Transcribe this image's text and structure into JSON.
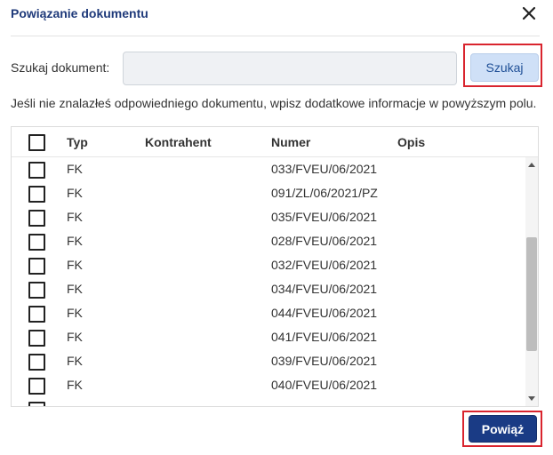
{
  "dialog": {
    "title": "Powiązanie dokumentu",
    "close_icon": "close-icon"
  },
  "search": {
    "label": "Szukaj dokument:",
    "value": "",
    "placeholder": "",
    "button_label": "Szukaj"
  },
  "info_text": "Jeśli nie znalazłeś odpowiedniego dokumentu, wpisz dodatkowe informacje w powyższym polu.",
  "table": {
    "headers": {
      "typ": "Typ",
      "kontrahent": "Kontrahent",
      "numer": "Numer",
      "opis": "Opis"
    },
    "rows": [
      {
        "typ": "FK",
        "kontrahent": "",
        "numer": "033/FVEU/06/2021",
        "opis": ""
      },
      {
        "typ": "FK",
        "kontrahent": "",
        "numer": "091/ZL/06/2021/PZ",
        "opis": ""
      },
      {
        "typ": "FK",
        "kontrahent": "",
        "numer": "035/FVEU/06/2021",
        "opis": ""
      },
      {
        "typ": "FK",
        "kontrahent": "",
        "numer": "028/FVEU/06/2021",
        "opis": ""
      },
      {
        "typ": "FK",
        "kontrahent": "",
        "numer": "032/FVEU/06/2021",
        "opis": ""
      },
      {
        "typ": "FK",
        "kontrahent": "",
        "numer": "034/FVEU/06/2021",
        "opis": ""
      },
      {
        "typ": "FK",
        "kontrahent": "",
        "numer": "044/FVEU/06/2021",
        "opis": ""
      },
      {
        "typ": "FK",
        "kontrahent": "",
        "numer": "041/FVEU/06/2021",
        "opis": ""
      },
      {
        "typ": "FK",
        "kontrahent": "",
        "numer": "039/FVEU/06/2021",
        "opis": ""
      },
      {
        "typ": "FK",
        "kontrahent": "",
        "numer": "040/FVEU/06/2021",
        "opis": ""
      }
    ]
  },
  "footer": {
    "submit_label": "Powiąż"
  },
  "colors": {
    "title": "#1f3a7a",
    "primary_button": "#1a3b85",
    "secondary_button": "#cfe0f7",
    "highlight": "#d9242e"
  }
}
